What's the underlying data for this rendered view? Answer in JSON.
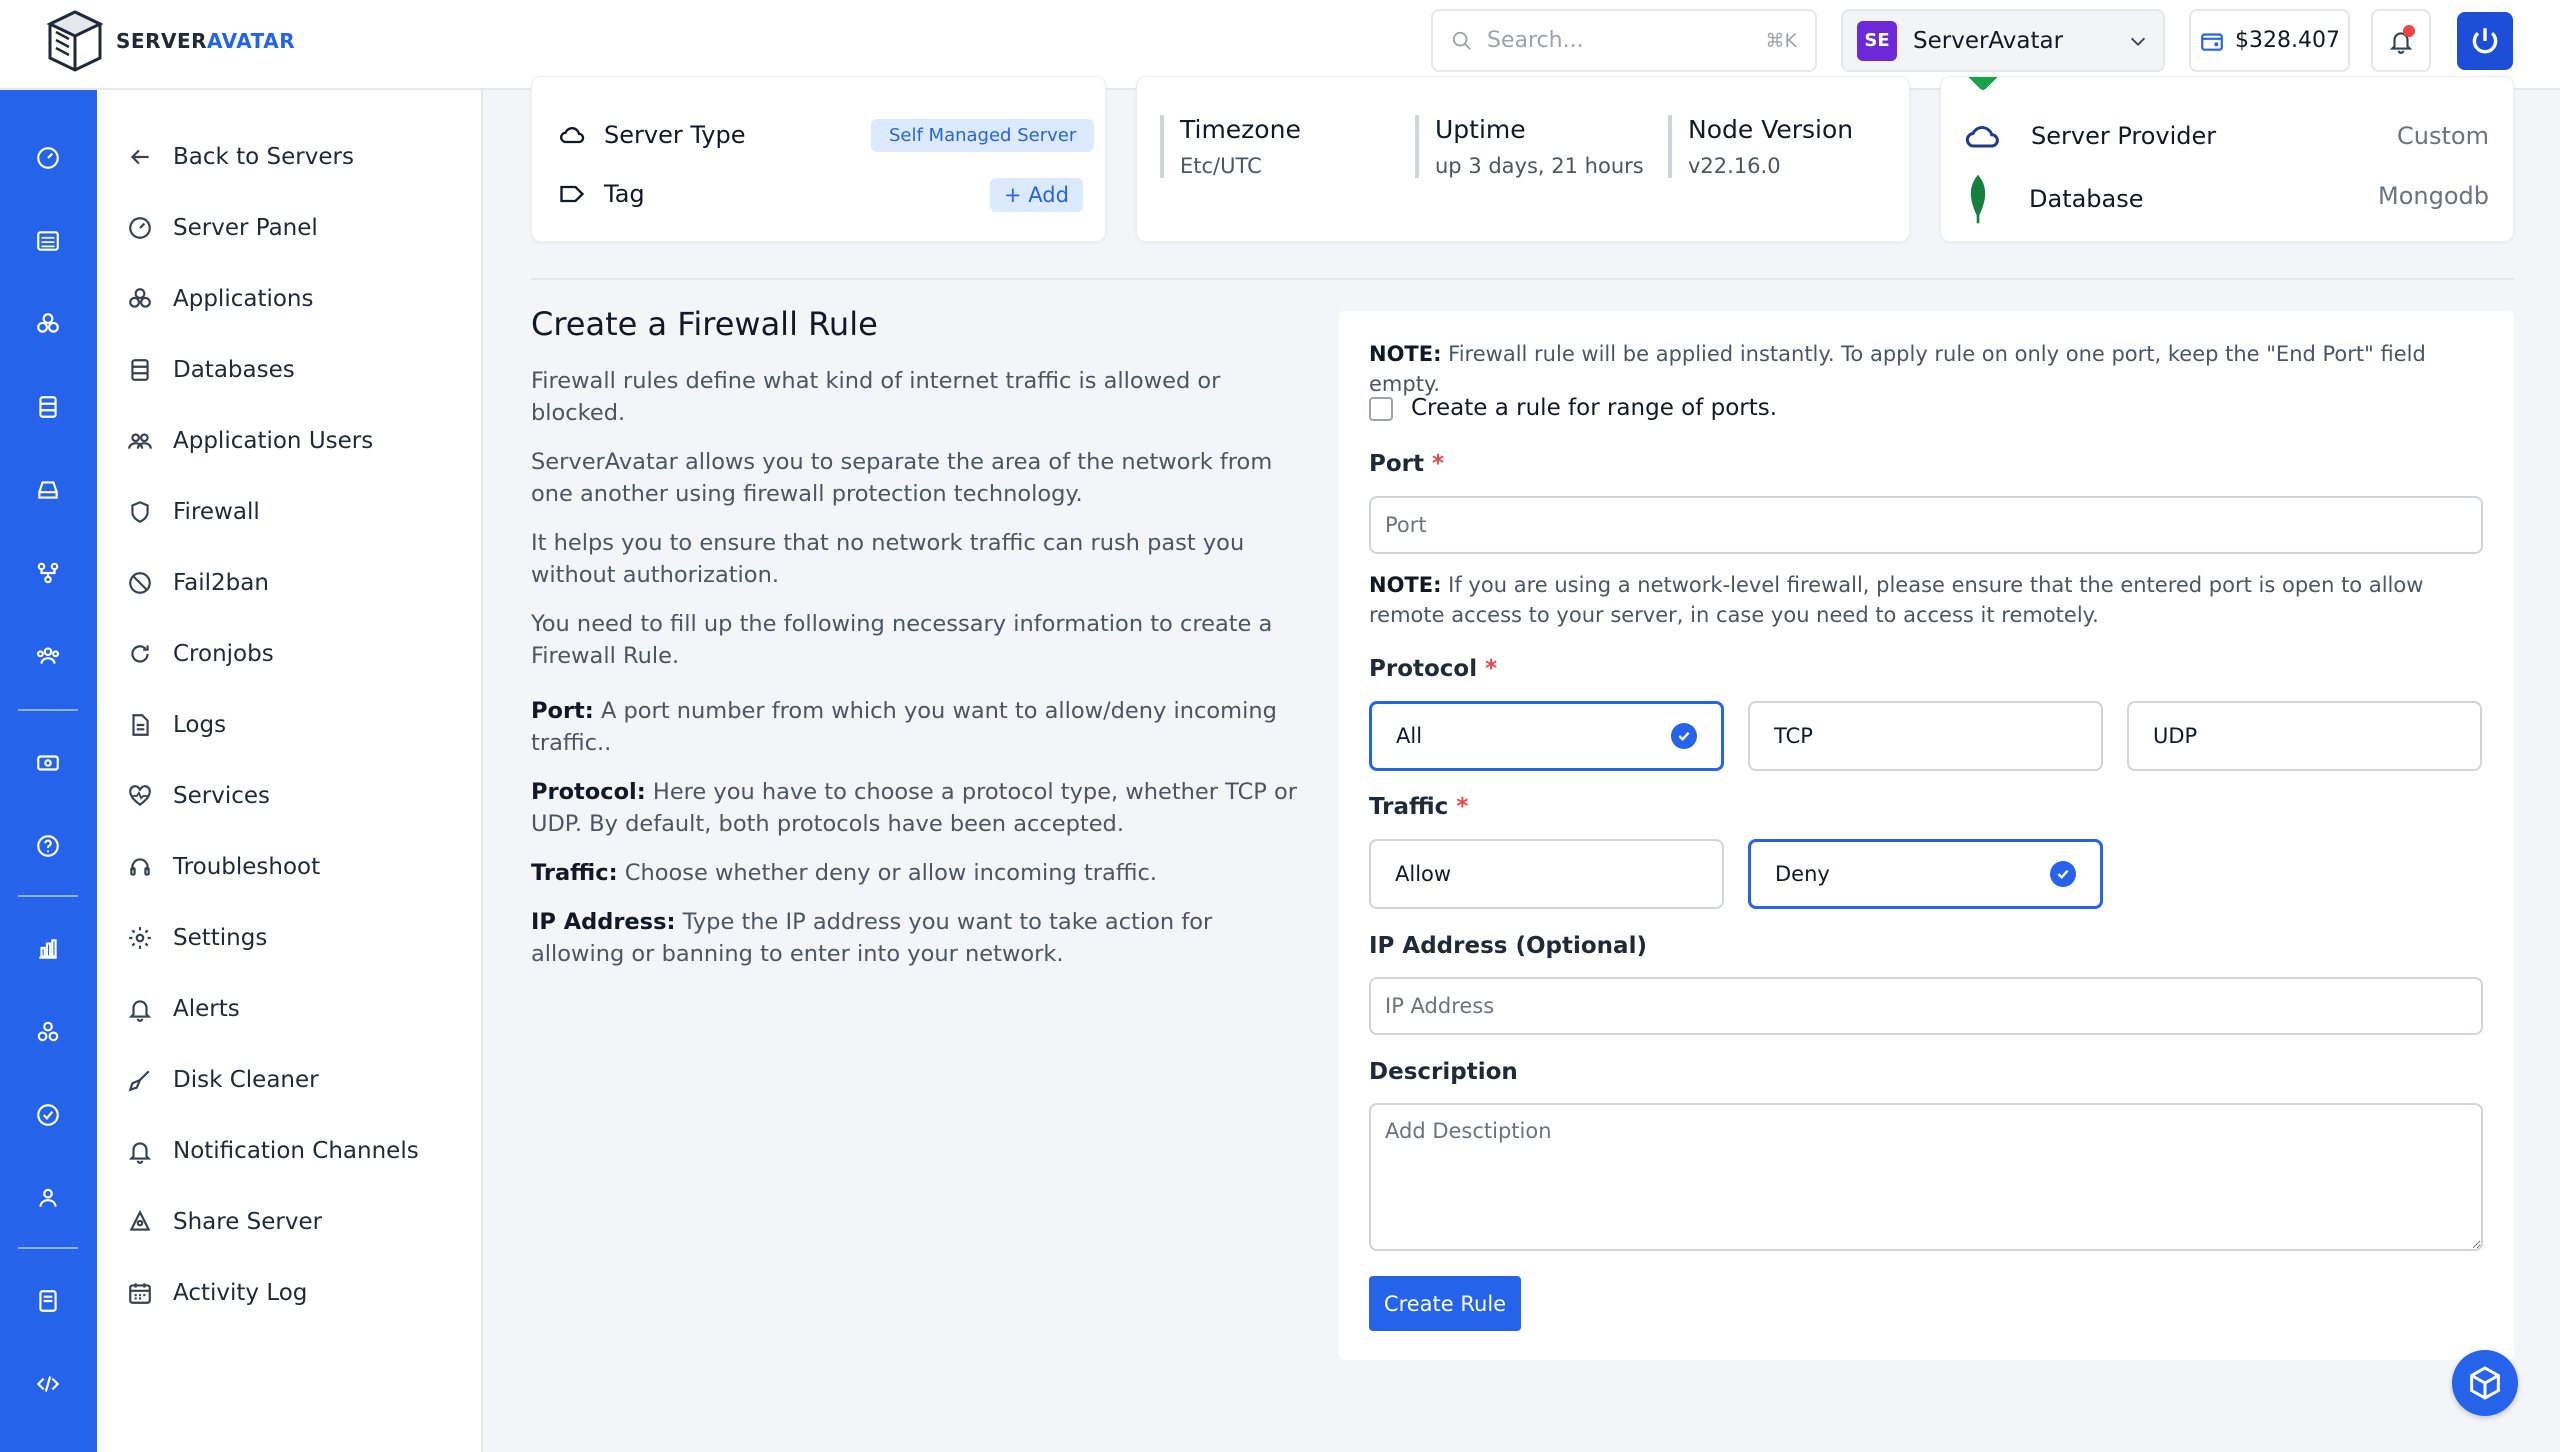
{
  "brand": {
    "name_part1": "SERVER",
    "name_part2": "AVATAR"
  },
  "header": {
    "search_placeholder": "Search...",
    "search_shortcut": "⌘K",
    "account_initials": "SE",
    "account_name": "ServerAvatar",
    "balance": "$328.407"
  },
  "sidebar": {
    "items": [
      {
        "label": "Back to Servers",
        "icon": "arrow-left-icon"
      },
      {
        "label": "Server Panel",
        "icon": "gauge-icon"
      },
      {
        "label": "Applications",
        "icon": "cubes-icon"
      },
      {
        "label": "Databases",
        "icon": "database-icon"
      },
      {
        "label": "Application Users",
        "icon": "users-icon"
      },
      {
        "label": "Firewall",
        "icon": "shield-icon"
      },
      {
        "label": "Fail2ban",
        "icon": "ban-icon"
      },
      {
        "label": "Cronjobs",
        "icon": "refresh-icon"
      },
      {
        "label": "Logs",
        "icon": "file-icon"
      },
      {
        "label": "Services",
        "icon": "heartbeat-icon"
      },
      {
        "label": "Troubleshoot",
        "icon": "headset-icon"
      },
      {
        "label": "Settings",
        "icon": "gear-icon"
      },
      {
        "label": "Alerts",
        "icon": "bell-icon"
      },
      {
        "label": "Disk Cleaner",
        "icon": "broom-icon"
      },
      {
        "label": "Notification Channels",
        "icon": "bell-icon"
      },
      {
        "label": "Share Server",
        "icon": "share-icon"
      },
      {
        "label": "Activity Log",
        "icon": "calendar-icon"
      }
    ]
  },
  "server_info": {
    "server_type_label": "Server Type",
    "server_type_value": "Self Managed Server",
    "tag_label": "Tag",
    "tag_add": "+ Add",
    "timezone_label": "Timezone",
    "timezone_value": "Etc/UTC",
    "uptime_label": "Uptime",
    "uptime_value": "up 3 days, 21 hours, ...",
    "node_label": "Node Version",
    "node_value": "v22.16.0",
    "provider_label": "Server Provider",
    "provider_value": "Custom",
    "database_label": "Database",
    "database_value": "Mongodb"
  },
  "intro": {
    "title": "Create a Firewall Rule",
    "p1": "Firewall rules define what kind of internet traffic is allowed or blocked.",
    "p2": "ServerAvatar allows you to separate the area of the network from one another using firewall protection technology.",
    "p3": "It helps you to ensure that no network traffic can rush past you without authorization.",
    "p4": "You need to fill up the following necessary information to create a Firewall Rule.",
    "port_term": "Port:",
    "port_desc": " A port number from which you want to allow/deny incoming traffic..",
    "protocol_term": "Protocol:",
    "protocol_desc": " Here you have to choose a protocol type, whether TCP or UDP. By default, both protocols have been accepted.",
    "traffic_term": "Traffic:",
    "traffic_desc": " Choose whether deny or allow incoming traffic.",
    "ip_term": "IP Address:",
    "ip_desc": " Type the IP address you want to take action for allowing or banning to enter into your network."
  },
  "form": {
    "note1_prefix": "NOTE:",
    "note1_text": " Firewall rule will be applied instantly. To apply rule on only one port, keep the \"End Port\" field empty.",
    "range_checkbox_label": "Create a rule for range of ports.",
    "port_label": "Port",
    "port_placeholder": "Port",
    "note2_prefix": "NOTE:",
    "note2_text": " If you are using a network-level firewall, please ensure that the entered port is open to allow remote access to your server, in case you need to access it remotely.",
    "protocol_label": "Protocol",
    "protocol_options": [
      "All",
      "TCP",
      "UDP"
    ],
    "protocol_selected": "All",
    "traffic_label": "Traffic",
    "traffic_options": [
      "Allow",
      "Deny"
    ],
    "traffic_selected": "Deny",
    "ip_label": "IP Address (Optional)",
    "ip_placeholder": "IP Address",
    "description_label": "Description",
    "description_placeholder": "Add Desctiption",
    "submit_label": "Create Rule",
    "required_mark": "*"
  },
  "colors": {
    "accent": "#2563eb",
    "required": "#ef4444"
  }
}
